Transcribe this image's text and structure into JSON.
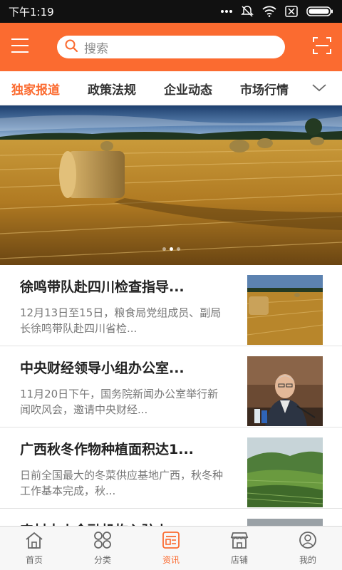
{
  "status_bar": {
    "time": "下午1:19"
  },
  "search": {
    "placeholder": "搜索"
  },
  "tabs": [
    {
      "label": "独家报道",
      "active": true
    },
    {
      "label": "政策法规",
      "active": false
    },
    {
      "label": "企业动态",
      "active": false
    },
    {
      "label": "市场行情",
      "active": false
    }
  ],
  "banner": {
    "dot_count": 3,
    "active_dot": 1
  },
  "news": [
    {
      "title": "徐鸣带队赴四川检查指导...",
      "desc": "12月13日至15日，粮食局党组成员、副局长徐鸣带队赴四川省检..."
    },
    {
      "title": "中央财经领导小组办公室...",
      "desc": "11月20日下午，国务院新闻办公室举行新闻吹风会，邀请中央财经..."
    },
    {
      "title": "广西秋冬作物种植面积达1...",
      "desc": "日前全国最大的冬菜供应基地广西，秋冬种工作基本完成，秋..."
    },
    {
      "title": "农村中小金融机构入驻上...",
      "desc": ""
    }
  ],
  "bottom_nav": [
    {
      "label": "首页",
      "icon": "home-icon",
      "active": false
    },
    {
      "label": "分类",
      "icon": "category-icon",
      "active": false
    },
    {
      "label": "资讯",
      "icon": "news-icon",
      "active": true
    },
    {
      "label": "店铺",
      "icon": "store-icon",
      "active": false
    },
    {
      "label": "我的",
      "icon": "profile-icon",
      "active": false
    }
  ],
  "colors": {
    "accent": "#fb6b30",
    "status_bar": "#111111",
    "text_primary": "#222222",
    "text_secondary": "#777777"
  }
}
